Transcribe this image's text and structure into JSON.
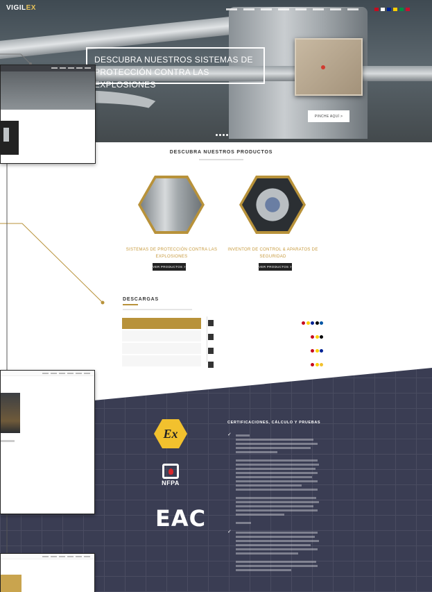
{
  "header": {
    "logo_prefix": "VIGIL",
    "logo_suffix": "EX",
    "nav_items": [
      "",
      "",
      "",
      "",
      "",
      "",
      "",
      ""
    ],
    "flag_colors": [
      "#c60b1e",
      "#ffffff",
      "#002395",
      "#ffce00",
      "#009246",
      "#c8102e"
    ]
  },
  "hero": {
    "headline": "DESCUBRA NUESTROS SISTEMAS DE PROTECCIÓN CONTRA LAS EXPLOSIONES",
    "button_label": "PINCHE AQUÍ >"
  },
  "products": {
    "title": "DESCUBRA NUESTROS PRODUCTOS",
    "items": [
      {
        "caption": "SISTEMAS DE PROTECCIÓN CONTRA LAS EXPLOSIONES",
        "button": "VER PRODUCTOS >"
      },
      {
        "caption": "INVENTOR DE CONTROL & APARATOS DE SEGURIDAD",
        "button": "VER PRODUCTOS >"
      }
    ]
  },
  "downloads": {
    "title": "DESCARGAS",
    "tabs": [
      "",
      "",
      "",
      ""
    ],
    "rows": [
      {
        "text": "",
        "flags": [
          "#c60b1e",
          "#ffce00",
          "#002395",
          "#000000",
          "#0055a4"
        ]
      },
      {
        "text": "",
        "flags": [
          "#c60b1e",
          "#ffce00",
          "#000000"
        ]
      },
      {
        "text": "",
        "flags": [
          "#c60b1e",
          "#ffce00",
          "#002395"
        ]
      },
      {
        "text": "",
        "flags": [
          "#c60b1e",
          "#ffce00",
          "#f2c12e"
        ]
      }
    ]
  },
  "certs": {
    "title": "CERTIFICACIONES, CÁLCULO Y PRUEBAS",
    "ex_logo": "Ex",
    "nfpa_label": "NFPA",
    "eac_label": "EAC"
  },
  "colors": {
    "accent": "#b8923a",
    "dark_bg": "#3a3d53",
    "hero_text": "#ffffff"
  }
}
